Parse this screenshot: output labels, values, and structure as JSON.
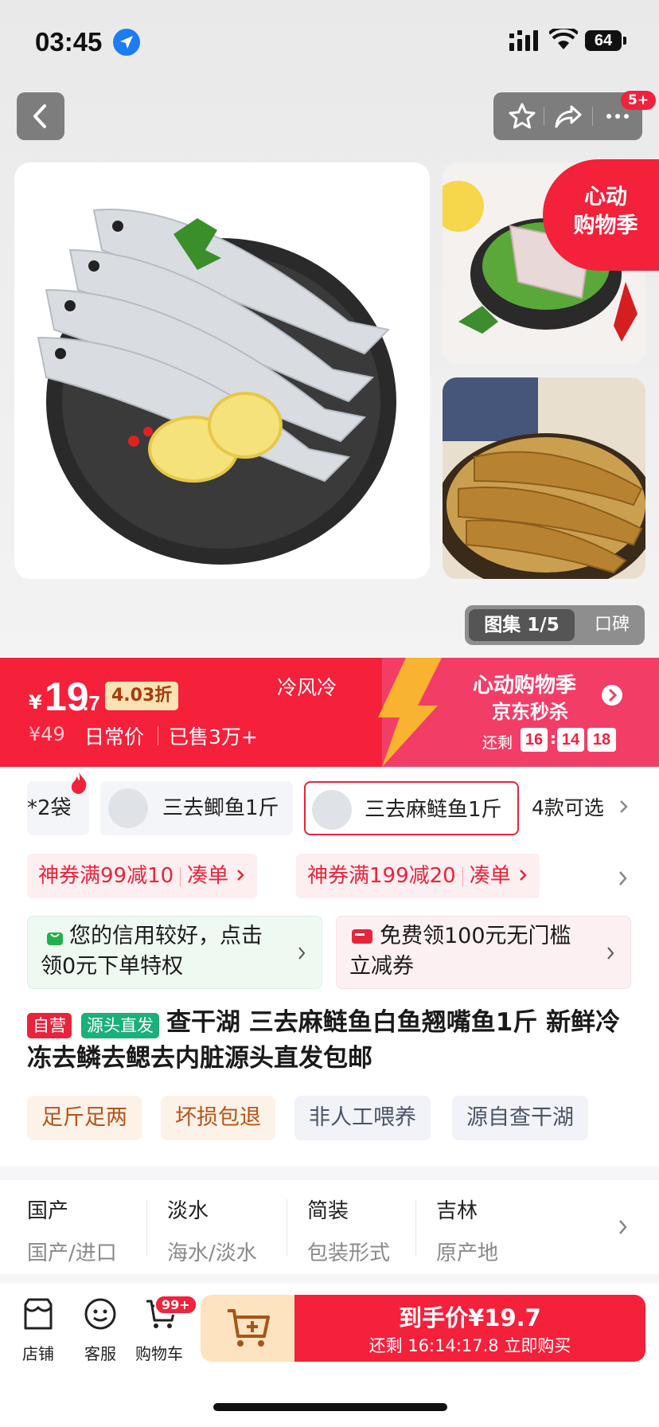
{
  "status_bar": {
    "time": "03:45",
    "battery": "64"
  },
  "top_bar": {
    "more_badge": "5+"
  },
  "gallery": {
    "promo_corner_line1": "心动",
    "promo_corner_line2": "购物季",
    "tab_active": "图集 1/5",
    "tab_reviews": "口碑"
  },
  "price": {
    "currency": "¥",
    "int": "19",
    "dec": ".7",
    "discount": "4.03折",
    "original": "¥49",
    "original_label": "日常价",
    "sold": "已售3万+",
    "storage": "冷风冷",
    "event_title": "心动购物季",
    "event_sub": "京东秒杀",
    "remain_label": "还剩",
    "countdown": [
      "16",
      "14",
      "18"
    ]
  },
  "variants": {
    "items": [
      "*2袋",
      "三去鲫鱼1斤",
      "三去麻鲢鱼1斤"
    ],
    "more": "4款可选"
  },
  "coupons": [
    {
      "text": "神券满99减10",
      "action": "凑单"
    },
    {
      "text": "神券满199减20",
      "action": "凑单"
    }
  ],
  "perks": [
    {
      "line1": "您的信用较好，点击",
      "line2": "领0元下单特权"
    },
    {
      "line1": "免费领100元无门槛",
      "line2": "立减券"
    }
  ],
  "product": {
    "tags": [
      "自营",
      "源头直发"
    ],
    "title": "查干湖 三去麻鲢鱼白鱼翘嘴鱼1斤 新鲜冷冻去鳞去鳃去内脏源头直发包邮"
  },
  "features": [
    "足斤足两",
    "坏损包退",
    "非人工喂养",
    "源自查干湖"
  ],
  "attributes": [
    {
      "value": "国产",
      "key": "国产/进口"
    },
    {
      "value": "淡水",
      "key": "海水/淡水"
    },
    {
      "value": "简装",
      "key": "包装形式"
    },
    {
      "value": "吉林",
      "key": "原产地"
    }
  ],
  "bottom_bar": {
    "store": "店铺",
    "service": "客服",
    "cart": "购物车",
    "cart_badge": "99+",
    "buy_main": "到手价¥19.7",
    "buy_sub": "还剩 16:14:17.8 立即购买"
  },
  "colors": {
    "brand_red": "#f5203a",
    "pink": "#f23e67",
    "green": "#22b04b"
  }
}
